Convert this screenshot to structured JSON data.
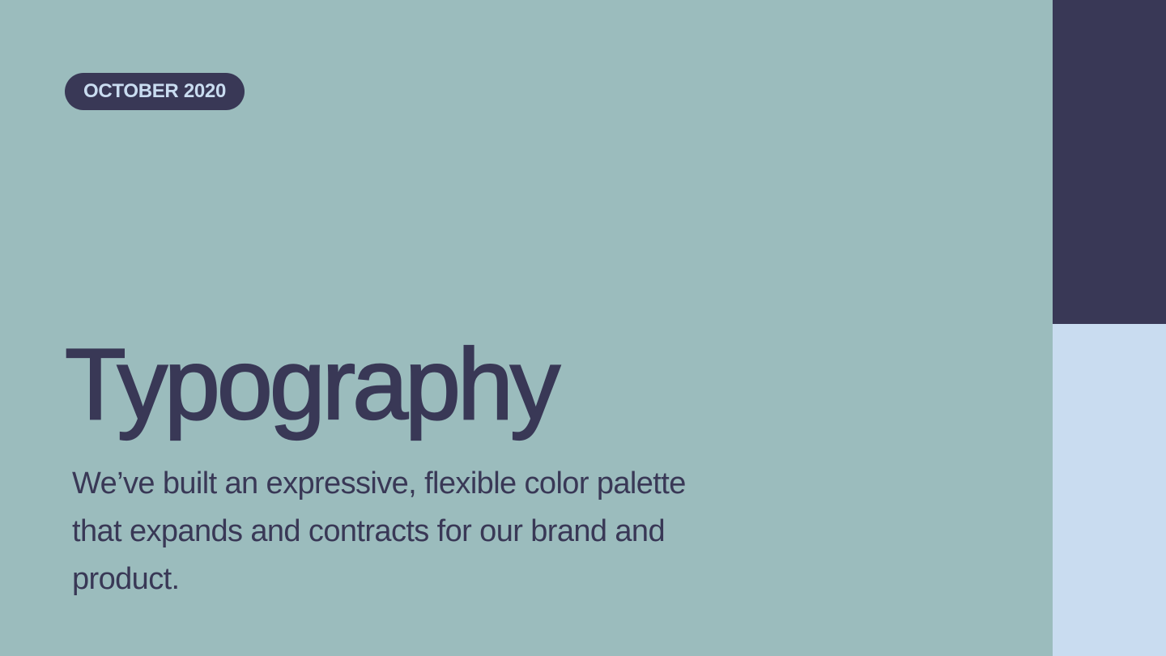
{
  "slide": {
    "date_label": "OCTOBER 2020",
    "title": "Typography",
    "subtitle": "We’ve built an expressive, flexible color palette that expands and contracts for our brand and product."
  },
  "colors": {
    "background": "#9BBCBD",
    "primary_dark": "#393856",
    "light_blue": "#C9DCF0"
  }
}
